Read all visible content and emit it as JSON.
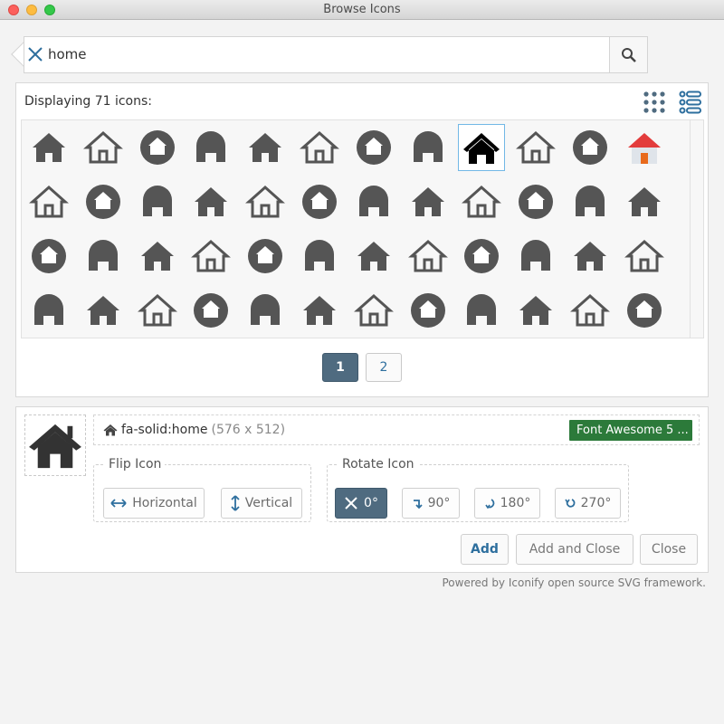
{
  "window": {
    "title": "Browse Icons"
  },
  "search": {
    "value": "home",
    "placeholder": ""
  },
  "results": {
    "header": "Displaying 71 icons:",
    "icons": [
      "home-solid-icon",
      "home-outline-icon",
      "home-line-icon",
      "home-chimney-icon",
      "home-big-solid-icon",
      "home-circle-icon",
      "home-circle-square-icon",
      "home-small-solid-icon",
      "home-selected-icon",
      "home-rounded-outline-icon",
      "home-door-outline-icon",
      "home-color-icon",
      "home-arch-icon",
      "home-roof-icon",
      "home-thin-icon",
      "home-chimney-2-icon",
      "home-simple-icon",
      "home-arch-outline-icon",
      "home-dome-icon",
      "home-farm-icon",
      "home-city-icon",
      "home-plus-icon",
      "smart-speaker-icon",
      "home-flat-icon",
      "home-account-icon",
      "home-alert-icon",
      "home-automation-icon",
      "home-wifi-icon",
      "home-circle-2-icon",
      "home-city-solid-icon",
      "home-city-outline-icon",
      "home-currency-icon",
      "home-heart-icon",
      "home-lock-icon",
      "home-lock-open-icon",
      "home-map-marker-icon",
      "home-minus-icon",
      "home-modern-icon",
      "home-outline-2-icon",
      "home-plus-2-icon",
      "home-variant-icon",
      "home-variant-outline-icon",
      "shield-home-icon",
      "shield-home-outline-icon",
      "home-thin-2-icon",
      "home-outline-3-icon",
      "home-filled-icon",
      "home-floor-icon"
    ],
    "pages": [
      "1",
      "2"
    ]
  },
  "details": {
    "icon_name": "fa-solid:home",
    "icon_size": "(576 x 512)",
    "collection": "Font Awesome 5 ...",
    "flip_legend": "Flip Icon",
    "flip_horizontal": "Horizontal",
    "flip_vertical": "Vertical",
    "rotate_legend": "Rotate Icon",
    "rotate_0": "0°",
    "rotate_90": "90°",
    "rotate_180": "180°",
    "rotate_270": "270°",
    "add": "Add",
    "add_close": "Add and Close",
    "close": "Close"
  },
  "footer": {
    "powered": "Powered by Iconify open source SVG framework."
  },
  "colors": {
    "accent": "#4f6b80",
    "badge": "#2c7a3a",
    "link": "#2e6f9e",
    "icon": "#555555"
  }
}
